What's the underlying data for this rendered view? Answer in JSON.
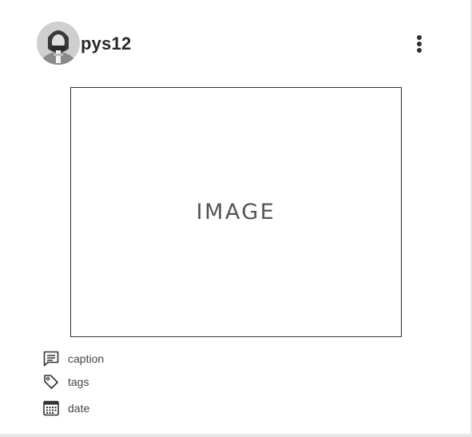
{
  "post": {
    "username": "pys12",
    "image_placeholder": "IMAGE",
    "meta": {
      "caption": "caption",
      "tags": "tags",
      "date": "date"
    }
  },
  "icons": {
    "avatar": "user-avatar",
    "menu": "more-vertical-icon",
    "caption": "comment-icon",
    "tags": "tag-icon",
    "date": "calendar-icon"
  },
  "colors": {
    "text": "#2a2a2a",
    "icon": "#333333",
    "border": "#333333"
  }
}
